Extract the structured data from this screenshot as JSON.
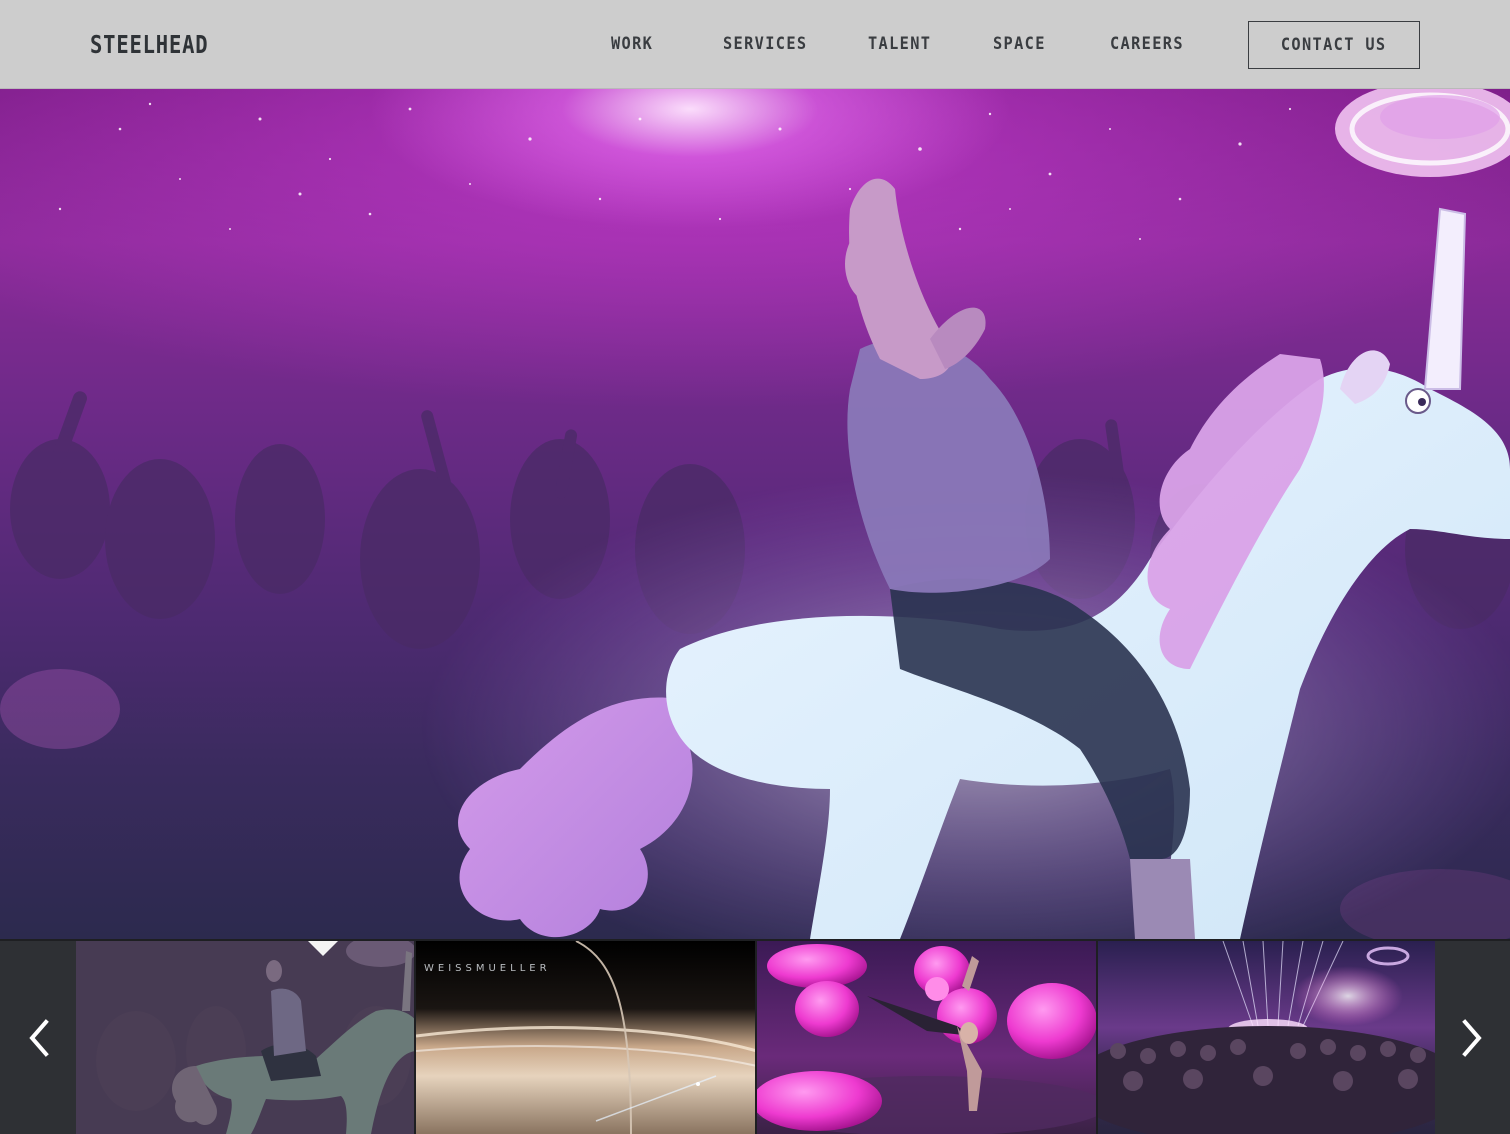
{
  "header": {
    "logo": "STEELHEAD",
    "nav": {
      "work": "WORK",
      "services": "SERVICES",
      "talent": "TALENT",
      "space": "SPACE",
      "careers": "CAREERS"
    },
    "contact_label": "CONTACT US"
  },
  "hero": {
    "image": "man riding glowing cartoon unicorn through cosmic concert crowd"
  },
  "filmstrip": {
    "active_index": 0,
    "thumbnails": [
      {
        "icon": "unicorn-rider-thumbnail",
        "caption": ""
      },
      {
        "icon": "planet-ring-thumbnail",
        "caption": "WEISSMUELLER"
      },
      {
        "icon": "floating-jellybeans-thumbnail",
        "caption": ""
      },
      {
        "icon": "laser-concert-thumbnail",
        "caption": ""
      }
    ],
    "prev_icon": "chevron-left-icon",
    "next_icon": "chevron-right-icon"
  },
  "colors": {
    "header_bg": "#cdcdcd",
    "nav_text": "#3a3d41",
    "hero_accent": "#b43ccc",
    "filmstrip_bg": "#2b2d31"
  }
}
